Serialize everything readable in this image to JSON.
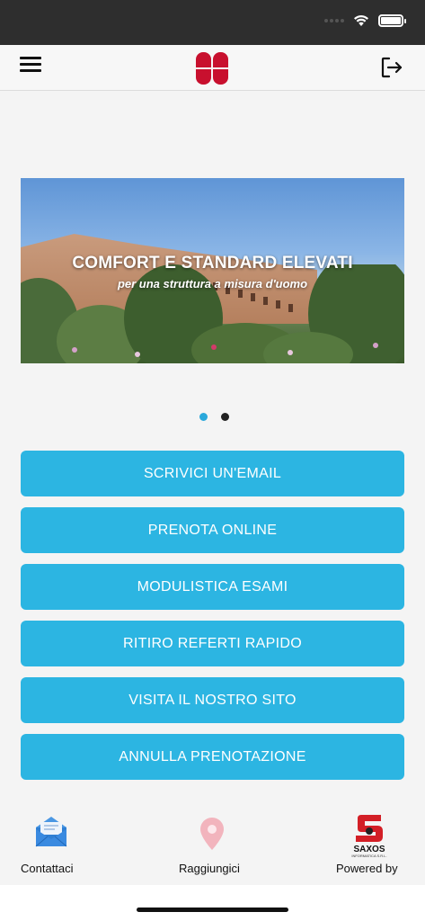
{
  "banner": {
    "title": "COMFORT E STANDARD ELEVATI",
    "subtitle": "per una struttura a misura d'uomo",
    "slide_count": 2,
    "active_slide": 1
  },
  "buttons": {
    "email": "SCRIVICI UN'EMAIL",
    "book_online": "PRENOTA ONLINE",
    "exam_forms": "MODULISTICA ESAMI",
    "quick_reports": "RITIRO REFERTI RAPIDO",
    "website": "VISITA IL NOSTRO SITO",
    "cancel_booking": "ANNULLA PRENOTAZIONE"
  },
  "tabs": {
    "contact": "Contattaci",
    "directions": "Raggiungici",
    "powered_by": "Powered by"
  },
  "branding": {
    "saxos_name": "SAXOS",
    "saxos_tagline": "INFORMATICA S.R.L."
  },
  "icons": {
    "menu": "hamburger-menu-icon",
    "logo": "four-leaf-logo",
    "logout": "logout-icon",
    "contact": "envelope-icon",
    "directions": "map-pin-icon"
  },
  "colors": {
    "accent": "#2cb5e2",
    "logo_red": "#c8102e",
    "pin_pink": "#f2b4bd"
  }
}
